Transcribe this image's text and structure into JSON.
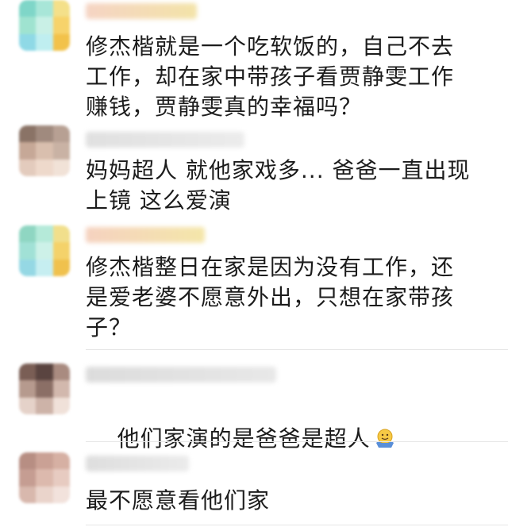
{
  "comments": [
    {
      "text": "修杰楷就是一个吃软饭的，自己不去\n工作，却在家中带孩子看贾静雯工作\n赚钱，贾静雯真的幸福吗？",
      "avatar_colors": [
        "#7fd6c8",
        "#a8e6d8",
        "#f4e08a",
        "#9fe3d0",
        "#c9f0e6",
        "#f7d36b",
        "#8fd9e6",
        "#bfeef0",
        "#f2c24a"
      ],
      "name_colors": [
        "#f5d4c4",
        "#f3e3a8"
      ]
    },
    {
      "text": "妈妈超人 就他家戏多... 爸爸一直出现\n上镜 这么爱演",
      "avatar_colors": [
        "#8a7366",
        "#a08a7e",
        "#b7a093",
        "#c6a897",
        "#d9bfae",
        "#c9b2a4",
        "#e3cbbd",
        "#eed9cb",
        "#f1e2d7"
      ],
      "name_colors": [
        "#e0e0e0",
        "#ececec"
      ]
    },
    {
      "text": "修杰楷整日在家是因为没有工作，还\n是爱老婆不愿意外出，只想在家带孩\n子？",
      "avatar_colors": [
        "#8fd6c2",
        "#b5ead9",
        "#f1df8c",
        "#a1e1d6",
        "#cdf1e8",
        "#f4d26a",
        "#95d8e4",
        "#c6eef1",
        "#f0c14d"
      ],
      "name_colors": [
        "#f5d2c0",
        "#f4e6a9"
      ]
    },
    {
      "text": "他们家演的是爸爸是超人",
      "avatar_colors": [
        "#7a5e55",
        "#5a4440",
        "#a98b80",
        "#b69a8e",
        "#8b6f66",
        "#d2b8ad",
        "#e5d2c9",
        "#cdb3a8",
        "#f0e1d9"
      ],
      "name_colors": [
        "#dcdcdc",
        "#e8e8e8"
      ],
      "emoji": "shrug-emoji"
    },
    {
      "text": "最不愿意看他们家",
      "avatar_colors": [
        "#b78e83",
        "#caa195",
        "#d6b0a3",
        "#c59d92",
        "#dcb9ad",
        "#e7cbc1",
        "#d8b8ad",
        "#ead4cb",
        "#f2e2dc"
      ],
      "name_colors": [
        "#dedede",
        "#ebebeb"
      ]
    }
  ]
}
